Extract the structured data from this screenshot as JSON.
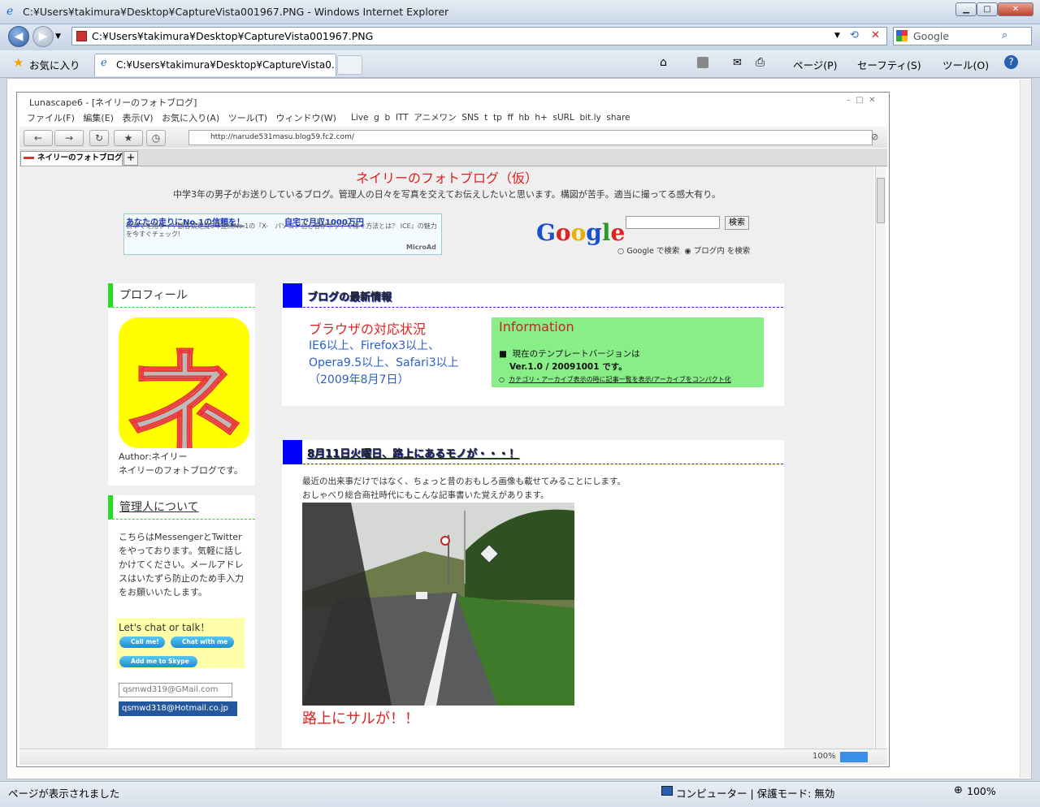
{
  "ie": {
    "title": "C:¥Users¥takimura¥Desktop¥CaptureVista001967.PNG - Windows Internet Explorer",
    "address": "C:¥Users¥takimura¥Desktop¥CaptureVista001967.PNG",
    "search_placeholder": "Google",
    "favorites": "お気に入り",
    "tab_label": "C:¥Users¥takimura¥Desktop¥CaptureVista0...",
    "page_menu": "ページ(P)",
    "safety_menu": "セーフティ(S)",
    "tools_menu": "ツール(O)",
    "status_text": "ページが表示されました",
    "zone": "コンピューター | 保護モード: 無効",
    "zoom": "100%"
  },
  "luna": {
    "title": "Lunascape6 - [ネイリーのフォトブログ]",
    "menu": [
      "ファイル(F)",
      "編集(E)",
      "表示(V)",
      "お気に入り(A)",
      "ツール(T)",
      "ウィンドウ(W)"
    ],
    "links": [
      "Live",
      "g",
      "b",
      "ITT",
      "アニメワン",
      "SNS",
      "t",
      "tp",
      "ff",
      "hb",
      "h+",
      "sURL",
      "bit.ly",
      "share"
    ],
    "url": "http://narude531masu.blog59.fc2.com/",
    "tab": "ネイリーのフォトブログ",
    "zoom": "100%"
  },
  "blog": {
    "title": "ネイリーのフォトブログ（仮）",
    "description": "中学3年の男子がお送りしているブログ。管理人の日々を写真を交えてお伝えしたいと思います。構図が苦手。適当に撮ってる感大有り。",
    "ad_link1": "あなたの走りにNo.1の信頼を！",
    "ad_link2": "自宅で月収1000万円",
    "ad_text": "日本で冬用タイヤ顧客満足度8年連続No.1の『X-　パソコン初心者がネットで稼ぐ方法とは？ ICE』の魅力を今すぐチェック!",
    "ad_brand": "MicroAd",
    "google": "Google",
    "search_button": "検索",
    "search_opt1": "Google で検索",
    "search_opt2": "ブログ内 を検索",
    "profile_head": "プロフィール",
    "profile_char": "ネ",
    "author": "Author:ネイリー",
    "author_desc": "ネイリーのフォトブログです。",
    "kanri_head": "管理人について",
    "kanri_text": "こちらはMessengerとTwitterをやっております。気軽に話しかけてください。メールアドレスはいたずら防止のため手入力をお願いいたします。",
    "chat_title": "Let's chat or talk！",
    "call_me": "Call me!",
    "chat_with_me": "Chat with me",
    "add_skype": "Add me to Skype",
    "gmail": "qsmwd319@GMail.com",
    "hotmail": "qsmwd318@Hotmail.co.jp",
    "latest_head": "ブログの最新情報",
    "browser_head": "ブラウザの対応状況",
    "browser_text": "IE6以上、Firefox3以上、Opera9.5以上、Safari3以上 （2009年8月7日）",
    "info_title": "Information",
    "info_line1": "現在のテンプレートバージョンは",
    "info_line2": "Ver.1.0 / 20091001 です。",
    "info_line3": "カテゴリ・アーカイブ表示の時に記事一覧を表示/アーカイブをコンパクト化",
    "post_title": "8月11日火曜日、路上にあるモノが・・・！",
    "post_text1": "最近の出来事だけではなく、ちょっと昔のおもしろ画像も載せてみることにします。",
    "post_text2": "おしゃべり総合商社時代にもこんな記事書いた覚えがあります。",
    "post_caption": "路上にサルが！！"
  },
  "colors": {
    "blog_red": "#dd2222",
    "side_green": "#22dd22",
    "main_blue": "#0000ff",
    "info_green": "#88ee88"
  }
}
